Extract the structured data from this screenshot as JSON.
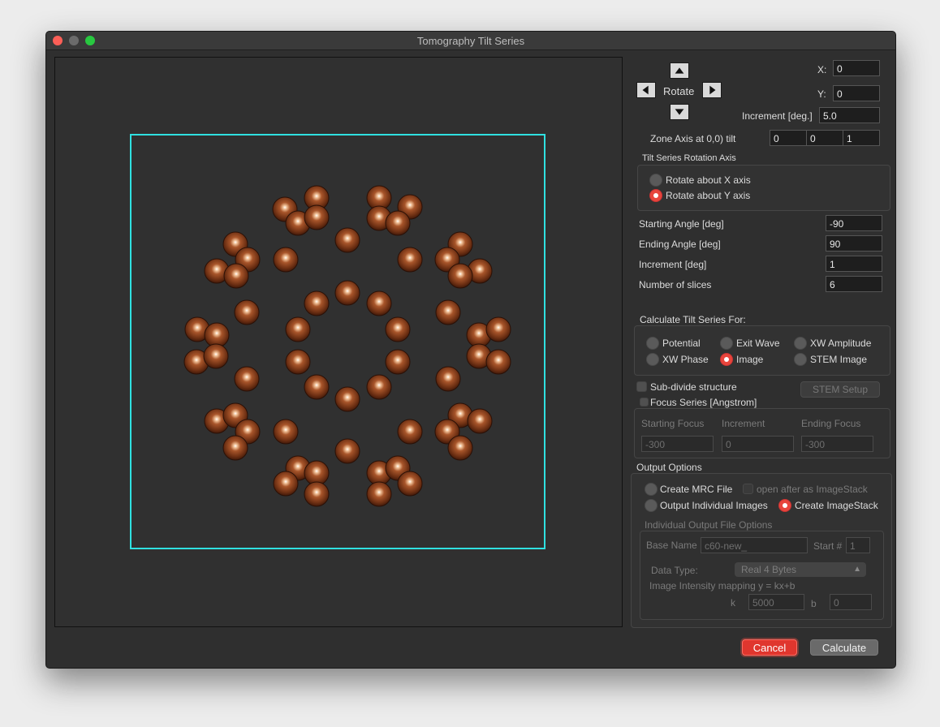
{
  "window": {
    "title": "Tomography Tilt Series"
  },
  "rotate": {
    "label": "Rotate",
    "x_label": "X:",
    "x_value": "0",
    "y_label": "Y:",
    "y_value": "0",
    "increment_label": "Increment [deg.]",
    "increment_value": "5.0",
    "zone_axis_label": "Zone Axis at 0,0) tilt",
    "zone_axis_values": [
      "0",
      "0",
      "1"
    ]
  },
  "axis_group": {
    "title": "Tilt Series Rotation Axis",
    "options": [
      {
        "label": "Rotate about X axis",
        "selected": false
      },
      {
        "label": "Rotate about Y axis",
        "selected": true
      }
    ]
  },
  "angles": {
    "starting_label": "Starting Angle [deg]",
    "starting_value": "-90",
    "ending_label": "Ending Angle [deg]",
    "ending_value": "90",
    "increment_label": "Increment [deg]",
    "increment_value": "1",
    "slices_label": "Number of slices",
    "slices_value": "6"
  },
  "calc_group": {
    "title": "Calculate Tilt Series For:",
    "options": [
      {
        "label": "Potential",
        "selected": false
      },
      {
        "label": "Exit Wave",
        "selected": false
      },
      {
        "label": "XW Amplitude",
        "selected": false
      },
      {
        "label": "XW Phase",
        "selected": false
      },
      {
        "label": "Image",
        "selected": true
      },
      {
        "label": "STEM Image",
        "selected": false
      }
    ]
  },
  "subdivide": {
    "label": "Sub-divide structure",
    "stem_setup_label": "STEM Setup"
  },
  "focus": {
    "label": "Focus Series [Angstrom]",
    "start_label": "Starting Focus",
    "start_value": "-300",
    "increment_label": "Increment",
    "increment_value": "0",
    "end_label": "Ending Focus",
    "end_value": "-300"
  },
  "output": {
    "title": "Output Options",
    "create_mrc_label": "Create MRC File",
    "open_after_label": "open after as ImageStack",
    "individual_label": "Output Individual Images",
    "imagestack_label": "Create ImageStack",
    "file_options_title": "Individual Output File Options",
    "base_name_label": "Base Name",
    "base_name_value": "c60-new_",
    "start_label": "Start #",
    "start_value": "1",
    "data_type_label": "Data Type:",
    "data_type_value": "Real 4 Bytes",
    "mapping_label": "Image Intensity mapping y = kx+b",
    "k_label": "k",
    "k_value": "5000",
    "b_label": "b",
    "b_value": "0"
  },
  "buttons": {
    "cancel": "Cancel",
    "calculate": "Calculate"
  },
  "colors": {
    "frame": "#2fe0e0",
    "atom_base": "#6b2e12",
    "accent": "#e0362e"
  }
}
